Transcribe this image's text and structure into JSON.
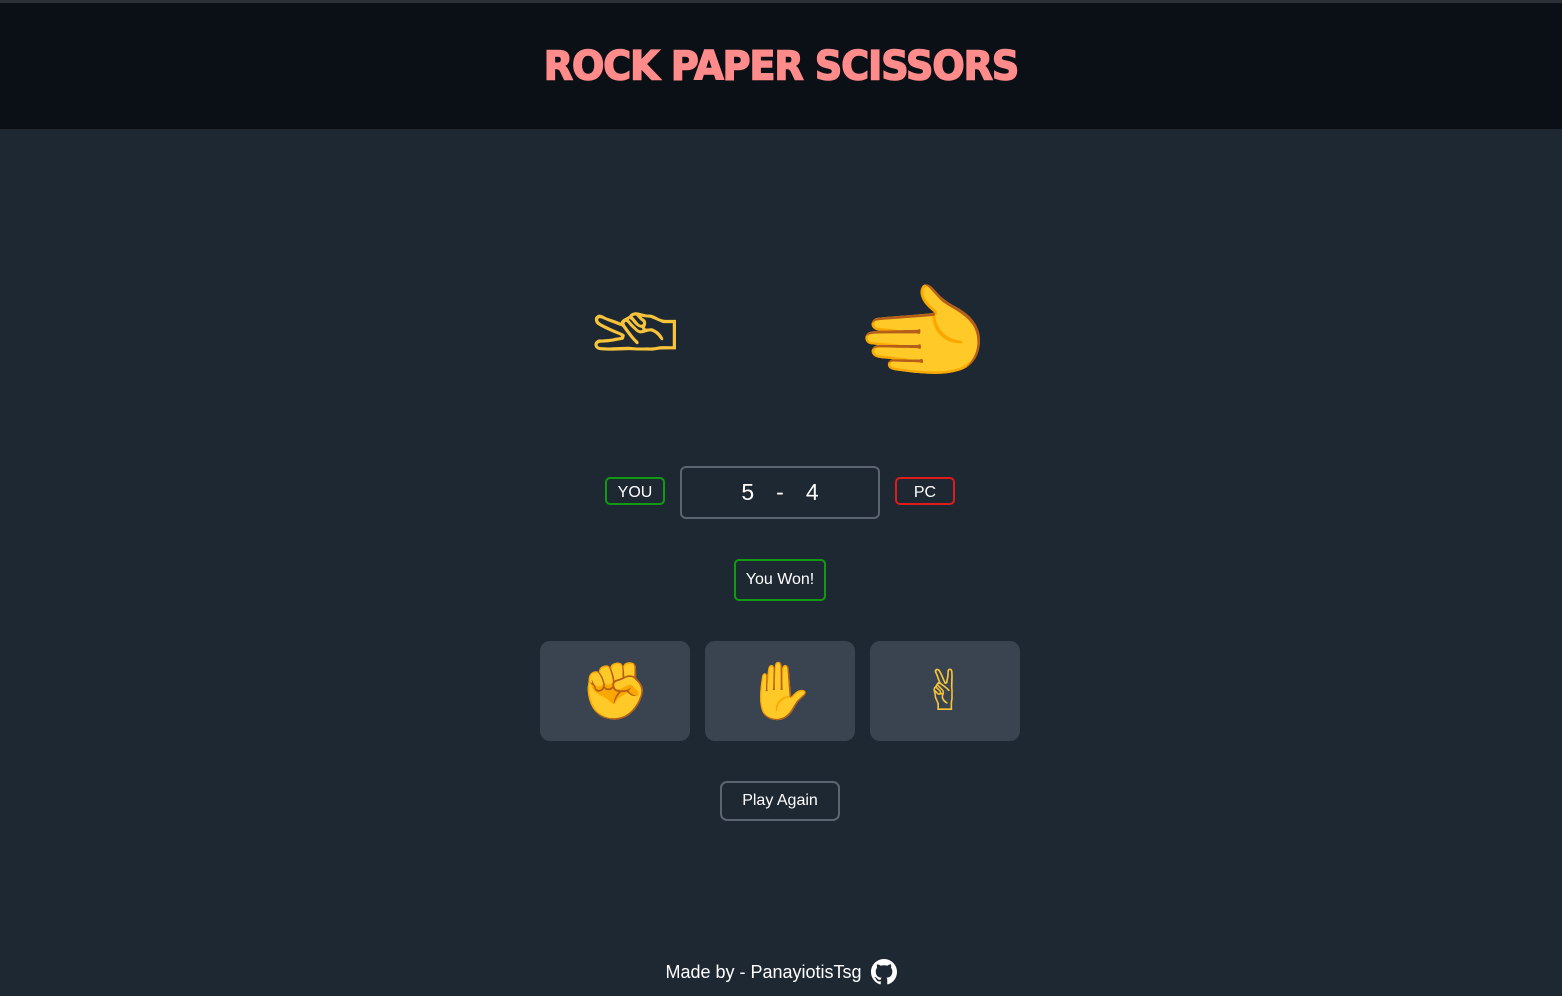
{
  "header": {
    "title": "ROCK PAPER SCISSORS"
  },
  "hands": {
    "player_icon": "victory-hand-sideways-icon",
    "player_glyph": "✌",
    "pc_icon": "open-hand-sideways-icon",
    "pc_glyph": "✋"
  },
  "score": {
    "you_label": "YOU",
    "pc_label": "PC",
    "you_score": "5",
    "separator": "-",
    "pc_score": "4"
  },
  "result": {
    "text": "You Won!"
  },
  "choices": [
    {
      "name": "rock",
      "icon": "raised-fist-icon",
      "glyph": "✊"
    },
    {
      "name": "paper",
      "icon": "raised-hand-icon",
      "glyph": "✋"
    },
    {
      "name": "scissors",
      "icon": "victory-hand-icon",
      "glyph": "✌"
    }
  ],
  "actions": {
    "play_again": "Play Again"
  },
  "footer": {
    "credit": "Made by - PanayiotisTsg",
    "icon": "github-icon"
  },
  "colors": {
    "background": "#1e2833",
    "header_bg": "#0b0f16",
    "title": "#ff8b8b",
    "win_border": "#129a12",
    "lose_border": "#e01b1b",
    "choice_bg": "#394450"
  }
}
